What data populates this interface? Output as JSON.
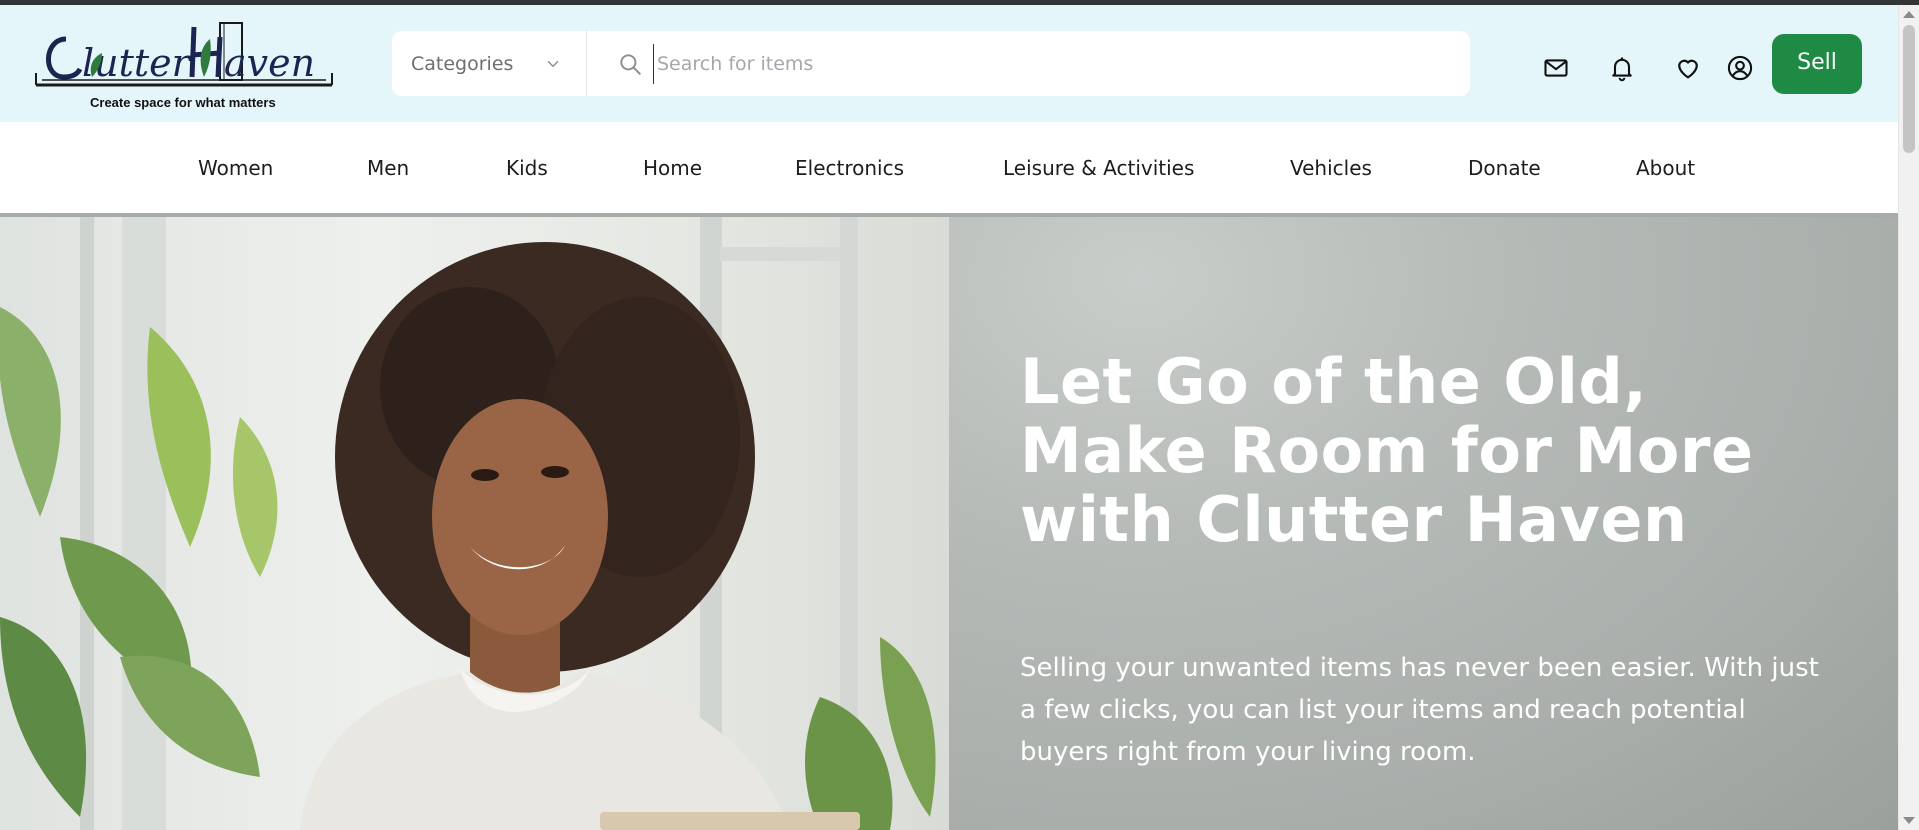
{
  "brand": {
    "logo_text": "Clutter Haven",
    "tagline": "Create space for what matters"
  },
  "search": {
    "category_label": "Categories",
    "placeholder": "Search for items"
  },
  "header_icons": [
    "mail-icon",
    "bell-icon",
    "heart-icon",
    "account-icon"
  ],
  "sell_label": "Sell",
  "nav": {
    "items": [
      {
        "label": "Women"
      },
      {
        "label": "Men"
      },
      {
        "label": "Kids"
      },
      {
        "label": "Home"
      },
      {
        "label": "Electronics"
      },
      {
        "label": "Leisure & Activities"
      },
      {
        "label": "Vehicles"
      },
      {
        "label": "Donate"
      },
      {
        "label": "About"
      }
    ]
  },
  "hero": {
    "title": "Let Go of the Old, Make Room for More with Clutter Haven",
    "text": "Selling your unwanted items has never been easier. With just a few clicks, you can list your items and reach potential buyers right from your living room."
  },
  "colors": {
    "header_bg": "#e5f6fb",
    "accent_green": "#1e8a44",
    "hero_bg": "#a9aeab"
  }
}
